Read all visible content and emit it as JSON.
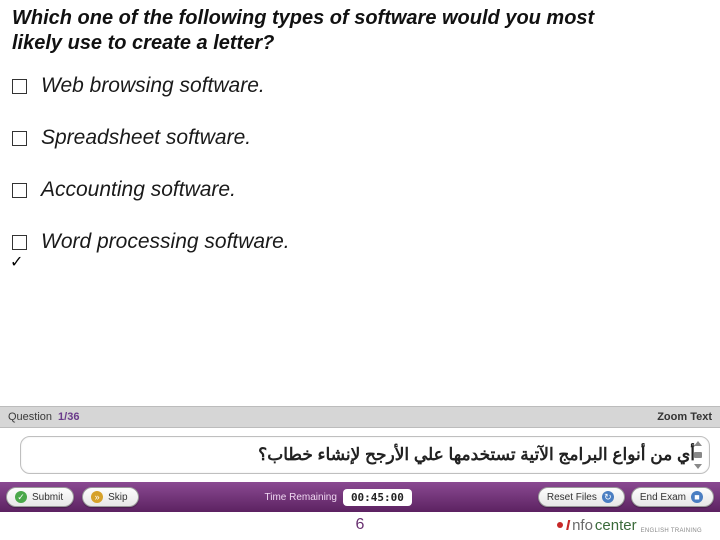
{
  "question": "Which one of the following types of software would you most likely use to create a letter?",
  "options": [
    {
      "label": "Web browsing software.",
      "checked": false
    },
    {
      "label": "Spreadsheet software.",
      "checked": false
    },
    {
      "label": "Accounting software.",
      "checked": false
    },
    {
      "label": "Word processing software.",
      "checked": true
    }
  ],
  "status": {
    "question_label": "Question",
    "counter": "1/36",
    "zoom_label": "Zoom Text"
  },
  "translation": "أي من أنواع البرامج الآتية تستخدمها علي الأرجح لإنشاء خطاب؟",
  "toolbar": {
    "submit": "Submit",
    "skip": "Skip",
    "time_label": "Time Remaining",
    "time_value": "00:45:00",
    "reset": "Reset Files",
    "end": "End Exam"
  },
  "footer": {
    "slide_number": "6",
    "logo_text_1": "nfo",
    "logo_text_2": "center",
    "logo_sub": "ENGLISH TRAINING"
  }
}
